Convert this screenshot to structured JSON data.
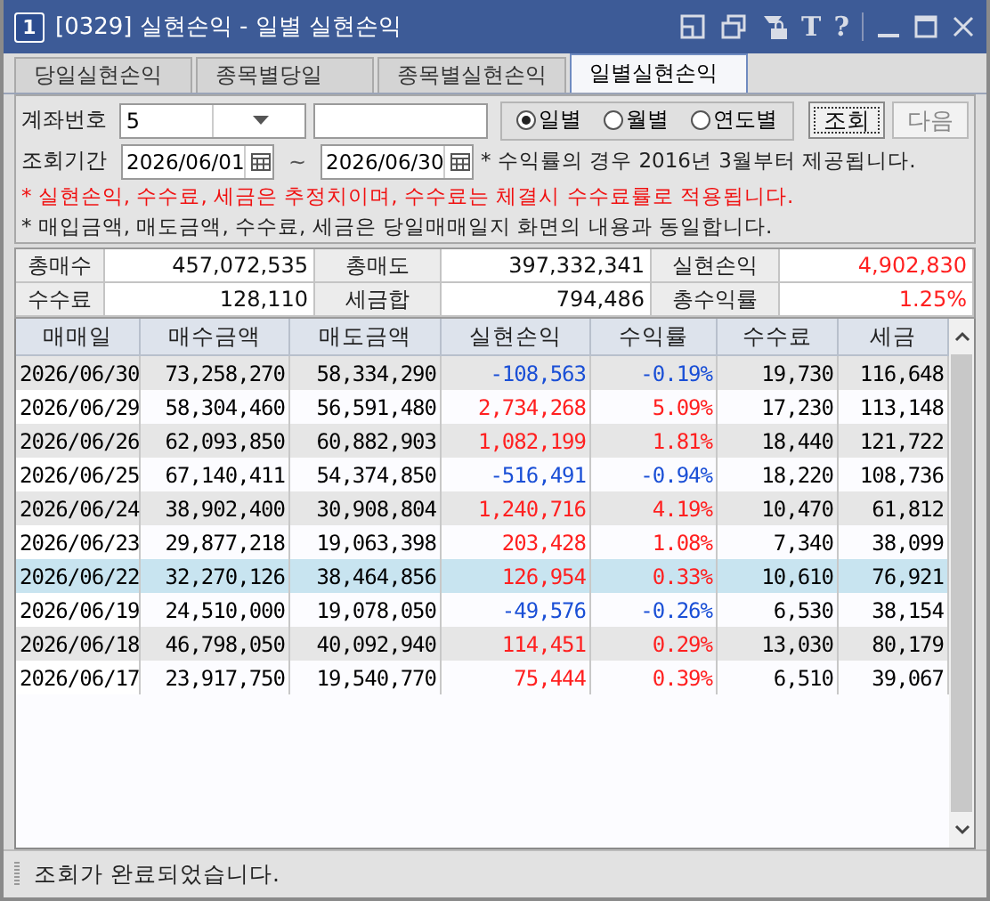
{
  "window": {
    "number": "1",
    "title": "[0329] 실현손익 - 일별 실현손익",
    "tools": [
      "T",
      "?"
    ]
  },
  "tabs": [
    {
      "label": "당일실현손익",
      "selected": false
    },
    {
      "label": "종목별당일",
      "selected": false
    },
    {
      "label": "종목별실현손익",
      "selected": false
    },
    {
      "label": "일별실현손익",
      "selected": true
    }
  ],
  "form": {
    "account_label": "계좌번호",
    "account_value": "5",
    "period_label": "조회기간",
    "start_date": "2026/06/01",
    "tilde": "~",
    "end_date": "2026/06/30",
    "period_note": "* 수익률의 경우 2016년 3월부터 제공됩니다.",
    "period_options": [
      {
        "label": "일별",
        "selected": true
      },
      {
        "label": "월별",
        "selected": false
      },
      {
        "label": "연도별",
        "selected": false
      }
    ],
    "buttons": [
      {
        "label": "조회",
        "disabled": false
      },
      {
        "label": "다음",
        "disabled": true
      }
    ],
    "notes": [
      {
        "text": "* 실현손익, 수수료, 세금은 추정치이며, 수수료는 체결시 수수료률로 적용됩니다.",
        "kind": "warning"
      },
      {
        "text": "* 매입금액, 매도금액, 수수료, 세금은 당일매매일지 화면의 내용과 동일합니다.",
        "kind": "info"
      }
    ]
  },
  "summary": [
    {
      "label": "총매수",
      "value": "457,072,535",
      "color": "#111111"
    },
    {
      "label": "총매도",
      "value": "397,332,341",
      "color": "#111111"
    },
    {
      "label": "실현손익",
      "value": "4,902,830",
      "color": "#ff2020"
    },
    {
      "label": "수수료",
      "value": "128,110",
      "color": "#111111"
    },
    {
      "label": "세금합",
      "value": "794,486",
      "color": "#111111"
    },
    {
      "label": "총수익률",
      "value": "1.25%",
      "color": "#ff2020"
    }
  ],
  "table": {
    "columns": [
      "매매일",
      "매수금액",
      "매도금액",
      "실현손익",
      "수익률",
      "수수료",
      "세금"
    ],
    "rows": [
      {
        "cells": [
          "2026/06/30",
          "73,258,270",
          "58,334,290",
          "-108,563",
          "-0.19%",
          "19,730",
          "116,648"
        ],
        "color": "#1a4fd6",
        "selected": false
      },
      {
        "cells": [
          "2026/06/29",
          "58,304,460",
          "56,591,480",
          "2,734,268",
          "5.09%",
          "17,230",
          "113,148"
        ],
        "color": "#ff2020",
        "selected": false
      },
      {
        "cells": [
          "2026/06/26",
          "62,093,850",
          "60,882,903",
          "1,082,199",
          "1.81%",
          "18,440",
          "121,722"
        ],
        "color": "#ff2020",
        "selected": false
      },
      {
        "cells": [
          "2026/06/25",
          "67,140,411",
          "54,374,850",
          "-516,491",
          "-0.94%",
          "18,220",
          "108,736"
        ],
        "color": "#1a4fd6",
        "selected": false
      },
      {
        "cells": [
          "2026/06/24",
          "38,902,400",
          "30,908,804",
          "1,240,716",
          "4.19%",
          "10,470",
          "61,812"
        ],
        "color": "#ff2020",
        "selected": false
      },
      {
        "cells": [
          "2026/06/23",
          "29,877,218",
          "19,063,398",
          "203,428",
          "1.08%",
          "7,340",
          "38,099"
        ],
        "color": "#ff2020",
        "selected": false
      },
      {
        "cells": [
          "2026/06/22",
          "32,270,126",
          "38,464,856",
          "126,954",
          "0.33%",
          "10,610",
          "76,921"
        ],
        "color": "#ff2020",
        "selected": true
      },
      {
        "cells": [
          "2026/06/19",
          "24,510,000",
          "19,078,050",
          "-49,576",
          "-0.26%",
          "6,530",
          "38,154"
        ],
        "color": "#1a4fd6",
        "selected": false
      },
      {
        "cells": [
          "2026/06/18",
          "46,798,050",
          "40,092,940",
          "114,451",
          "0.29%",
          "13,030",
          "80,179"
        ],
        "color": "#ff2020",
        "selected": false
      },
      {
        "cells": [
          "2026/06/17",
          "23,917,750",
          "19,540,770",
          "75,444",
          "0.39%",
          "6,510",
          "39,067"
        ],
        "color": "#ff2020",
        "selected": false
      }
    ]
  },
  "status_bar": {
    "message": "조회가 완료되었습니다."
  }
}
